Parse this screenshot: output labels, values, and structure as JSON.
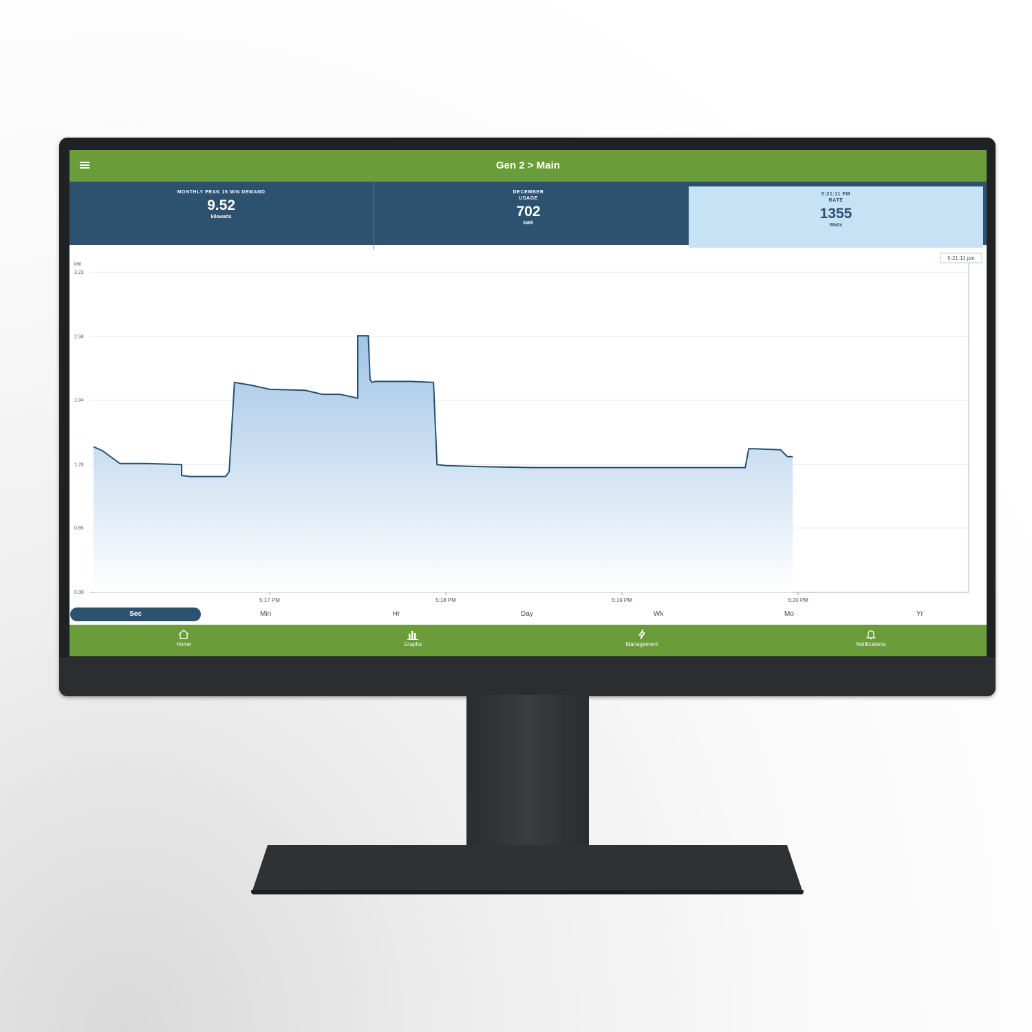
{
  "header": {
    "title": "Gen 2 > Main"
  },
  "stats": [
    {
      "label": "MONTHLY PEAK 15 MIN DEMAND",
      "value": "9.52",
      "unit": "kilowatts"
    },
    {
      "label_line1": "DECEMBER",
      "label_line2": "USAGE",
      "value": "702",
      "unit": "kWh"
    },
    {
      "label_line1": "5:21:11 PM",
      "label_line2": "RATE",
      "value": "1355",
      "unit": "Watts"
    }
  ],
  "chart_data": {
    "type": "area",
    "ylabel": "kW",
    "ylim": [
      0,
      3.23
    ],
    "yticks": [
      "3.23",
      "2.58",
      "1.94",
      "1.29",
      "0.65",
      "0.00"
    ],
    "xticks": [
      "5:17 PM",
      "5:18 PM",
      "5:19 PM",
      "5:20 PM"
    ],
    "cursor_label": "5:21:11 pm",
    "x_minutes": [
      0,
      0.05,
      0.15,
      0.3,
      0.5,
      0.5,
      0.55,
      0.75,
      0.77,
      0.8,
      0.9,
      1.0,
      1.2,
      1.3,
      1.4,
      1.5,
      1.5,
      1.56,
      1.57,
      1.58,
      1.6,
      1.7,
      1.8,
      1.93,
      1.95,
      2.0,
      2.2,
      2.5,
      2.8,
      3.0,
      3.2,
      3.5,
      3.7,
      3.72,
      3.75,
      3.9,
      3.94,
      3.97
    ],
    "values": [
      1.47,
      1.43,
      1.3,
      1.3,
      1.29,
      1.18,
      1.17,
      1.17,
      1.22,
      2.12,
      2.09,
      2.05,
      2.04,
      2.0,
      2.0,
      1.96,
      2.59,
      2.59,
      2.15,
      2.12,
      2.13,
      2.13,
      2.13,
      2.12,
      1.29,
      1.28,
      1.27,
      1.26,
      1.26,
      1.26,
      1.26,
      1.26,
      1.26,
      1.45,
      1.45,
      1.44,
      1.37,
      1.37
    ]
  },
  "ranges": [
    "Sec",
    "Min",
    "Hr",
    "Day",
    "Wk",
    "Mo",
    "Yr"
  ],
  "nav": [
    {
      "label": "Home",
      "icon": "home-icon"
    },
    {
      "label": "Graphs",
      "icon": "bar-chart-icon"
    },
    {
      "label": "Management",
      "icon": "lightning-icon"
    },
    {
      "label": "Notifications",
      "icon": "bell-icon"
    }
  ],
  "colors": {
    "green": "#6a9c3a",
    "navy": "#2d5270",
    "highlight": "#c7e1f5",
    "line": "#24506e"
  }
}
